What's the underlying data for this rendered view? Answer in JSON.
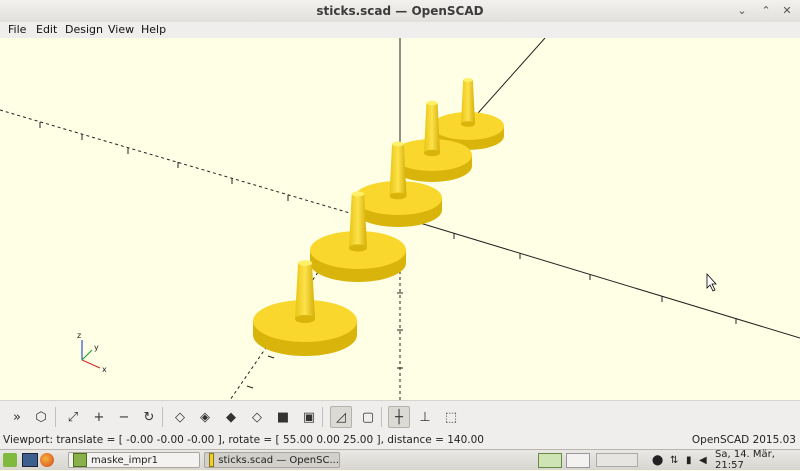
{
  "window": {
    "title": "sticks.scad — OpenSCAD"
  },
  "menu": [
    "File",
    "Edit",
    "Design",
    "View",
    "Help"
  ],
  "toolbar": {
    "buttons": [
      {
        "name": "preview-icon",
        "glyph": "»"
      },
      {
        "name": "render-icon",
        "glyph": "⬡"
      },
      {
        "name": "view-all-icon",
        "glyph": "⤢"
      },
      {
        "name": "zoom-in-icon",
        "glyph": "+"
      },
      {
        "name": "zoom-out-icon",
        "glyph": "−"
      },
      {
        "name": "reset-view-icon",
        "glyph": "↻"
      },
      {
        "name": "view-right-icon",
        "glyph": "◇"
      },
      {
        "name": "view-top-icon",
        "glyph": "◈"
      },
      {
        "name": "view-bottom-icon",
        "glyph": "◆"
      },
      {
        "name": "view-left-icon",
        "glyph": "◇"
      },
      {
        "name": "view-front-icon",
        "glyph": "■"
      },
      {
        "name": "view-back-icon",
        "glyph": "▣"
      },
      {
        "name": "perspective-icon",
        "glyph": "◿"
      },
      {
        "name": "orthogonal-icon",
        "glyph": "▢"
      },
      {
        "name": "show-axes-icon",
        "glyph": "┼"
      },
      {
        "name": "show-scale-icon",
        "glyph": "⊥"
      },
      {
        "name": "show-edges-icon",
        "glyph": "⬚"
      }
    ]
  },
  "status": {
    "viewport": "Viewport: translate = [ -0.00 -0.00 -0.00 ], rotate = [ 55.00 0.00 25.00 ], distance = 140.00",
    "version": "OpenSCAD 2015.03"
  },
  "taskbar": {
    "tasks": [
      {
        "label": "maske_impr1"
      },
      {
        "label": "sticks.scad — OpenSC..."
      }
    ],
    "clock": "Sa, 14. Mär, 21:57"
  },
  "colors": {
    "model": "#f9d72c",
    "model_dark": "#d9b40a",
    "background": "#ffffe5",
    "axis": "#222222"
  },
  "axes_labels": {
    "x": "x",
    "y": "y",
    "z": "z"
  }
}
